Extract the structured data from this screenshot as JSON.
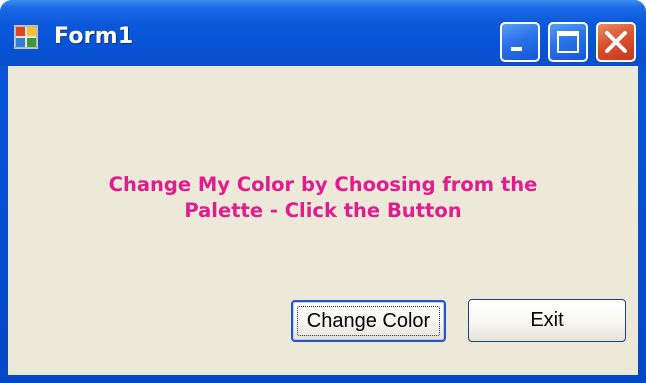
{
  "window": {
    "title": "Form1",
    "icon": "form-app-icon"
  },
  "title_buttons": {
    "minimize_icon": "minimize-icon",
    "maximize_icon": "maximize-icon",
    "close_icon": "close-icon"
  },
  "content": {
    "message": "Change My Color by Choosing from the\nPalette - Click the Button",
    "message_color": "#e21b8f",
    "background_color": "#ece9d8"
  },
  "buttons": {
    "change_color_label": "Change Color",
    "exit_label": "Exit"
  }
}
